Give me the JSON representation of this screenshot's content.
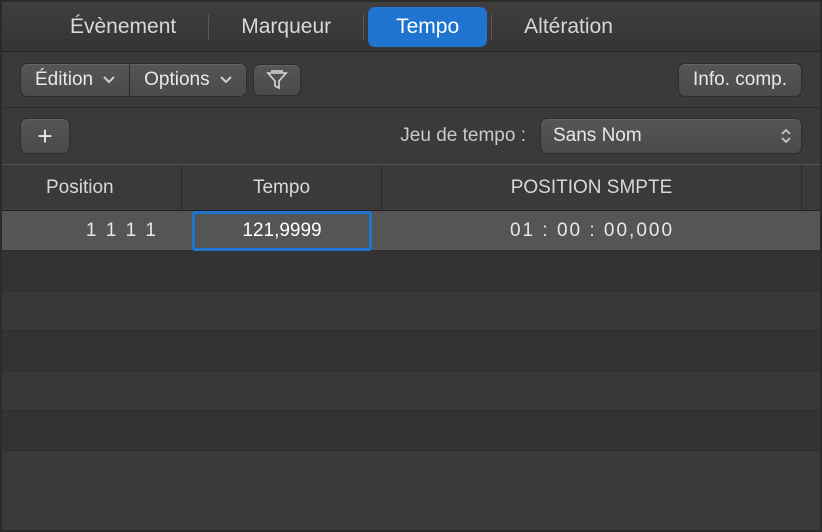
{
  "tabs": {
    "event": "Évènement",
    "marker": "Marqueur",
    "tempo": "Tempo",
    "alteration": "Altération",
    "active": "tempo"
  },
  "toolbar": {
    "edit_label": "Édition",
    "options_label": "Options",
    "info_label": "Info. comp."
  },
  "tempo_set": {
    "label": "Jeu de tempo :",
    "selected": "Sans Nom"
  },
  "columns": {
    "position": "Position",
    "tempo": "Tempo",
    "smpte": "POSITION SMPTE"
  },
  "rows": [
    {
      "position": "1 1 1    1",
      "tempo": "121,9999",
      "smpte": "01 : 00 : 00,000"
    }
  ],
  "icons": {
    "plus": "+",
    "chevron": "▾"
  }
}
